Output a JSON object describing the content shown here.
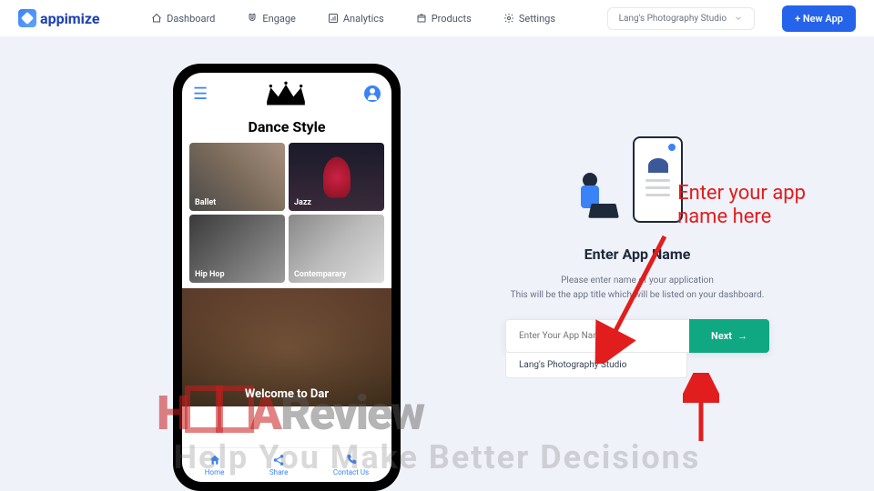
{
  "brand": "appimize",
  "nav": {
    "dashboard": "Dashboard",
    "engage": "Engage",
    "analytics": "Analytics",
    "products": "Products",
    "settings": "Settings"
  },
  "studio_selected": "Lang's Photography Studio",
  "new_app_btn": "+ New App",
  "phone": {
    "section_title": "Dance Style",
    "cards": {
      "ballet": "Ballet",
      "jazz": "Jazz",
      "hiphop": "Hip Hop",
      "contemporary": "Contemparary"
    },
    "hero_text": "Welcome to Dar",
    "bottom_nav": {
      "home": "Home",
      "share": "Share",
      "contact": "Contact Us"
    }
  },
  "form": {
    "title": "Enter App Name",
    "desc_line1": "Please enter name of your application",
    "desc_line2": "This will be the app title which will be listed on your dashboard.",
    "placeholder": "Enter Your App Name",
    "next": "Next",
    "suggestion": "Lang's Photography Studio"
  },
  "annotation": {
    "line1": "Enter your app",
    "line2": "name here"
  },
  "watermark": {
    "tagline": "Help You Make Better Decisions",
    "logo_text": "Review"
  }
}
